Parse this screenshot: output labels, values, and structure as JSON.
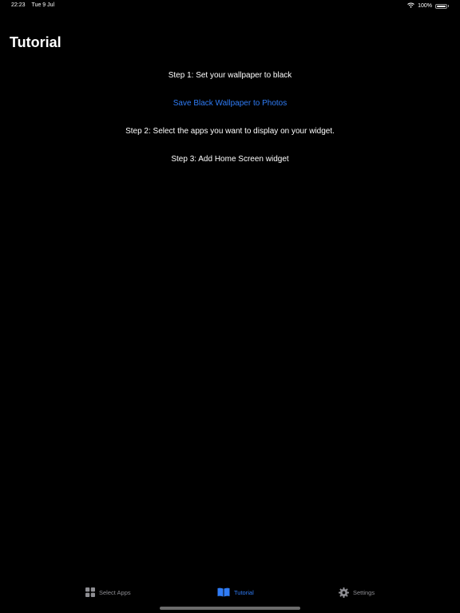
{
  "status_bar": {
    "time": "22:23",
    "date": "Tue 9 Jul",
    "battery_percent": "100%",
    "battery_level": 1.0
  },
  "page": {
    "title": "Tutorial"
  },
  "steps": {
    "step1": "Step 1: Set your wallpaper to black",
    "save_link": "Save Black Wallpaper to Photos",
    "step2": "Step 2: Select the apps you want to display on your widget.",
    "step3": "Step 3: Add Home Screen widget"
  },
  "tab_bar": {
    "tabs": [
      {
        "label": "Select Apps",
        "icon": "grid-icon",
        "active": false
      },
      {
        "label": "Tutorial",
        "icon": "book-icon",
        "active": true
      },
      {
        "label": "Settings",
        "icon": "gear-icon",
        "active": false
      }
    ]
  },
  "colors": {
    "accent": "#2f7cf6",
    "inactive": "#8e8e93",
    "background": "#000000"
  }
}
